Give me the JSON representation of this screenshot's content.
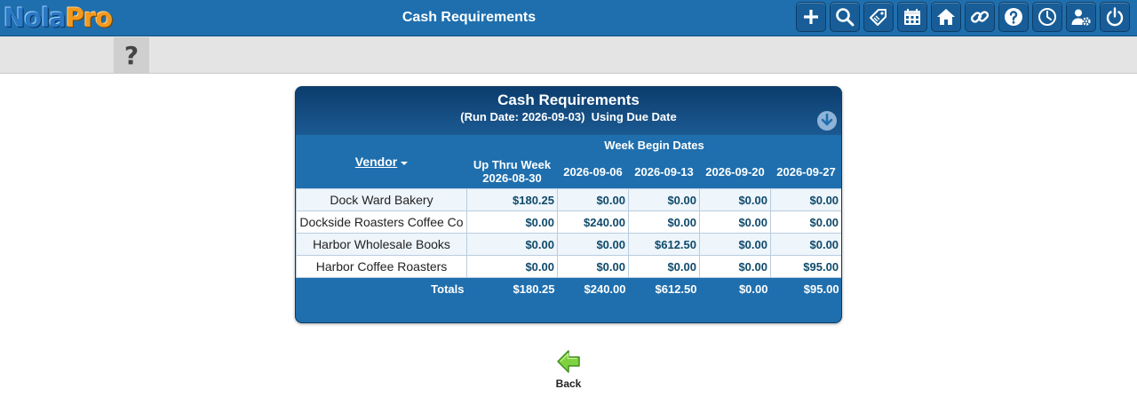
{
  "app": {
    "logo_part1": "Nola",
    "logo_part2": "Pro",
    "title": "Cash Requirements"
  },
  "toolbar": {
    "icons": [
      "plus-icon",
      "search-icon",
      "tag-icon",
      "calendar-icon",
      "home-icon",
      "link-icon",
      "help-icon",
      "clock-icon",
      "user-settings-icon",
      "power-icon"
    ]
  },
  "help": {
    "label": "?"
  },
  "report": {
    "title": "Cash Requirements",
    "subtitle": "(Run Date: 2026-09-03)  Using Due Date",
    "week_group_label": "Week Begin Dates",
    "vendor_header": "Vendor",
    "columns": [
      "Up Thru Week 2026-08-30",
      "2026-09-06",
      "2026-09-13",
      "2026-09-20",
      "2026-09-27"
    ],
    "rows": [
      {
        "vendor": "Dock Ward Bakery",
        "values": [
          "$180.25",
          "$0.00",
          "$0.00",
          "$0.00",
          "$0.00"
        ]
      },
      {
        "vendor": "Dockside Roasters Coffee Co",
        "values": [
          "$0.00",
          "$240.00",
          "$0.00",
          "$0.00",
          "$0.00"
        ]
      },
      {
        "vendor": "Harbor Wholesale Books",
        "values": [
          "$0.00",
          "$0.00",
          "$612.50",
          "$0.00",
          "$0.00"
        ]
      },
      {
        "vendor": "Harbor Coffee Roasters",
        "values": [
          "$0.00",
          "$0.00",
          "$0.00",
          "$0.00",
          "$95.00"
        ]
      }
    ],
    "totals": {
      "label": "Totals",
      "values": [
        "$180.25",
        "$240.00",
        "$612.50",
        "$0.00",
        "$95.00"
      ]
    }
  },
  "back": {
    "label": "Back"
  },
  "colors": {
    "header_blue": "#1f6fae",
    "dark_blue": "#0c3d6e",
    "number_text": "#0f4a6b",
    "back_arrow": "#7fd23f"
  }
}
